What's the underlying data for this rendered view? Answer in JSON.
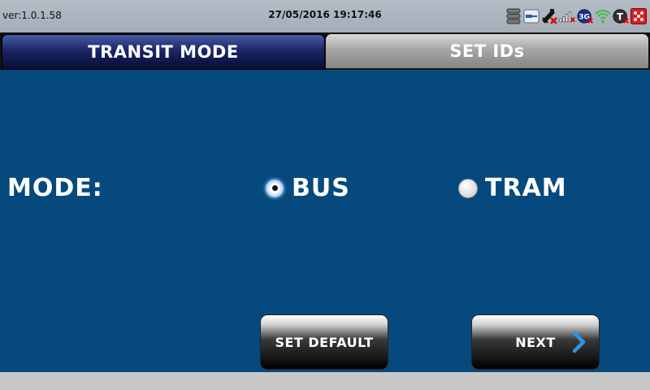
{
  "status": {
    "version": "ver:1.0.1.58",
    "datetime": "27/05/2016 19:17:46",
    "icons": [
      "database-icon",
      "card-reader-icon",
      "gps-satellite-icon",
      "signal-strength-icon",
      "3g-icon",
      "wifi-icon",
      "t-icon",
      "alert-icon"
    ],
    "network_label": "3G",
    "t_label": "T"
  },
  "tabs": [
    {
      "label": "TRANSIT MODE",
      "active": true
    },
    {
      "label": "SET IDs",
      "active": false
    }
  ],
  "mode": {
    "label": "MODE:",
    "options": [
      {
        "label": "BUS",
        "selected": true
      },
      {
        "label": "TRAM",
        "selected": false
      }
    ]
  },
  "buttons": {
    "set_default": "SET DEFAULT",
    "next": "NEXT"
  },
  "colors": {
    "main_bg": "#064a7d",
    "active_tab": "#1a2666",
    "accent": "#2a95e8"
  }
}
